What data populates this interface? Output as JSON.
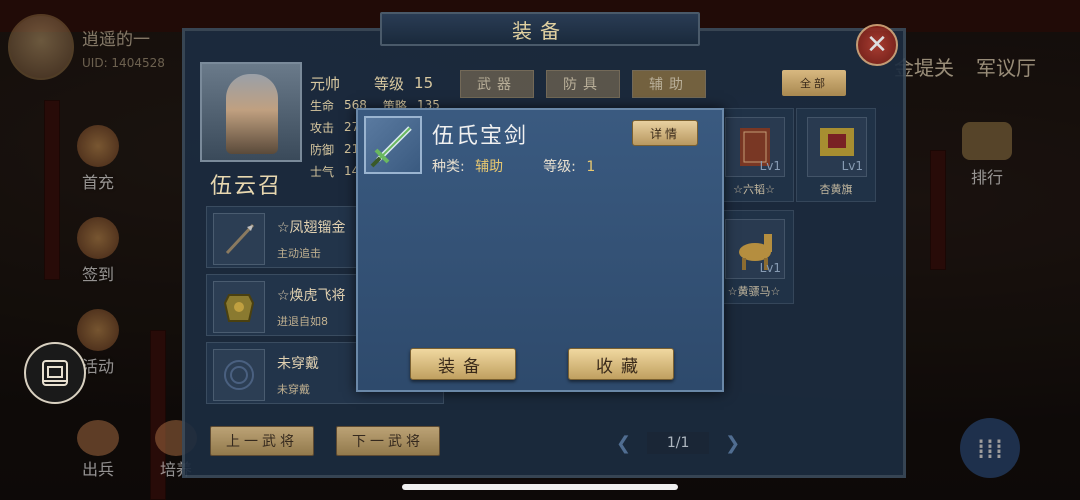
{
  "player": {
    "name": "逍遥的一",
    "uid": "UID: 1404528"
  },
  "left_menu": [
    {
      "label": "首充",
      "icon": "first-charge-icon"
    },
    {
      "label": "签到",
      "icon": "sign-in-icon"
    },
    {
      "label": "活动",
      "icon": "event-icon"
    }
  ],
  "bottom_menu": [
    {
      "label": "出兵",
      "icon": "dispatch-icon"
    },
    {
      "label": "培养",
      "icon": "train-icon"
    }
  ],
  "top_right_nav": [
    "金堤关",
    "军议厅"
  ],
  "rank_label": "排行",
  "panel": {
    "title": "装备",
    "hero": {
      "name": "伍云召",
      "title": "元帅",
      "level_label": "等级",
      "level": "15",
      "stats": [
        {
          "label": "生命",
          "value": "568",
          "label2": "策略",
          "value2": "135"
        },
        {
          "label": "攻击",
          "value": "27"
        },
        {
          "label": "防御",
          "value": "21"
        },
        {
          "label": "士气",
          "value": "14"
        }
      ]
    },
    "slots": [
      {
        "name": "☆凤翅镏金",
        "desc": "主动追击"
      },
      {
        "name": "☆焕虎飞将",
        "desc": "进退自如8"
      },
      {
        "name": "未穿戴",
        "desc": "未穿戴"
      }
    ],
    "prev_button": "上一武将",
    "next_button": "下一武将",
    "tabs": [
      "武器",
      "防具",
      "辅助"
    ],
    "active_tab": "辅助",
    "all_button": "全部",
    "items": [
      {
        "name": "☆六韬☆",
        "level": "Lv1"
      },
      {
        "name": "杏黄旗",
        "level": "Lv1"
      },
      {
        "name": "☆黄骠马☆",
        "level": "Lv1"
      }
    ],
    "pager": {
      "text": "1/1"
    }
  },
  "popup": {
    "item_name": "伍氏宝剑",
    "detail_button": "详情",
    "type_label": "种类:",
    "type_value": "辅助",
    "level_label": "等级:",
    "level_value": "1",
    "equip_button": "装备",
    "favorite_button": "收藏"
  },
  "colors": {
    "popup_bg": "#3a5a80",
    "gold_button": "#d8b880",
    "panel_bg": "#1c2c40"
  }
}
